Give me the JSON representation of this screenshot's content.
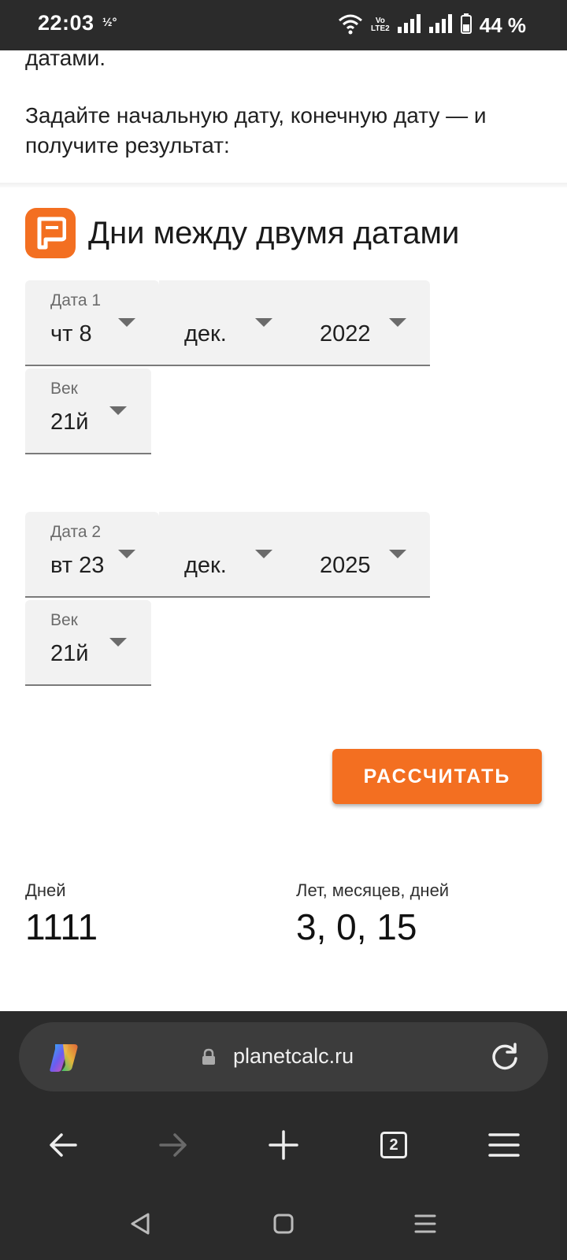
{
  "status_bar": {
    "time": "22:03",
    "extra": "½°",
    "volte_line1": "Vo",
    "volte_line2": "LTE2",
    "battery_text": "44 %"
  },
  "page": {
    "intro_tail": "датами.",
    "intro_text": "Задайте начальную дату, конечную дату — и получите результат:"
  },
  "calculator": {
    "title": "Дни между двумя датами",
    "date1": {
      "label": "Дата 1",
      "day": "чт 8",
      "month": "дек.",
      "year": "2022"
    },
    "century1": {
      "label": "Век",
      "value": "21й"
    },
    "date2": {
      "label": "Дата 2",
      "day": "вт 23",
      "month": "дек.",
      "year": "2025"
    },
    "century2": {
      "label": "Век",
      "value": "21й"
    },
    "calculate_label": "РАССЧИТАТЬ"
  },
  "results": {
    "days_label": "Дней",
    "days_value": "1111",
    "ymd_label": "Лет, месяцев, дней",
    "ymd_value": "3, 0, 15"
  },
  "browser": {
    "url": "planetcalc.ru",
    "tabs_count": "2"
  },
  "colors": {
    "accent": "#f36f21",
    "chrome": "#2b2b2b",
    "url_pill": "#3c3c3c",
    "field_bg": "#f2f2f2"
  }
}
